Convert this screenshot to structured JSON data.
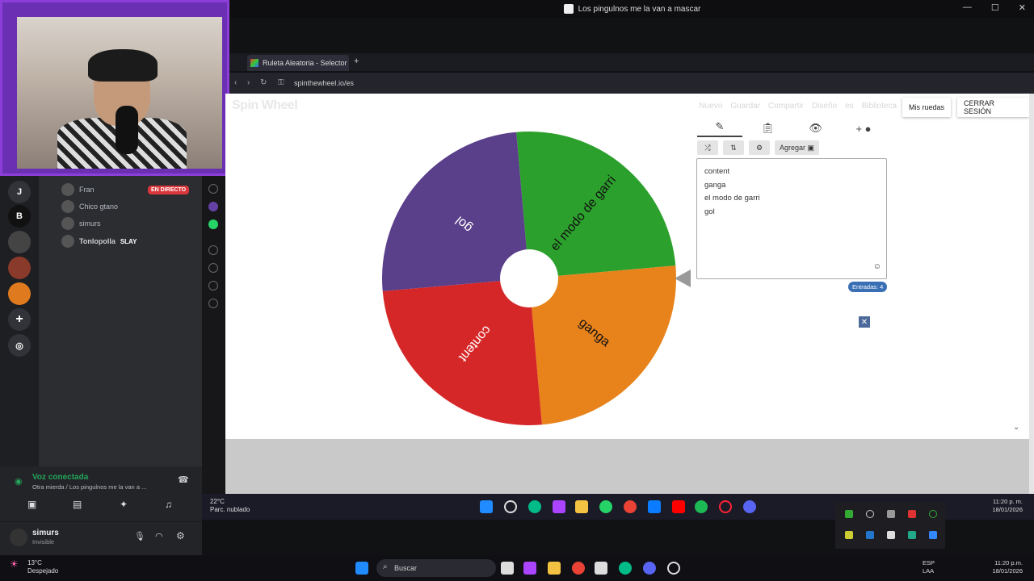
{
  "stream_window": {
    "title": "Los pingulnos me la van a mascar"
  },
  "browser": {
    "tab_title": "Ruleta Aleatoria - Selector",
    "url": "spinthewheel.io/es"
  },
  "site": {
    "logo": "Spin Wheel",
    "nav": [
      "Nuevo",
      "Guardar",
      "Compartir",
      "Diseño",
      "es",
      "Biblioteca"
    ],
    "my_wheels": "Mis ruedas",
    "logout": "CERRAR SESIÓN",
    "add_image": "Agregar",
    "entries_text": [
      "content",
      "ganga",
      "el modo de garri",
      "gol"
    ],
    "entries_count": "Entradas: 4"
  },
  "wheel": {
    "segments": [
      {
        "label": "el modo de garri",
        "color": "#2ca02c"
      },
      {
        "label": "ganga",
        "color": "#e8831c"
      },
      {
        "label": "content",
        "color": "#d62728"
      },
      {
        "label": "gol",
        "color": "#5a3f8a"
      }
    ]
  },
  "discord": {
    "servers": [
      "J",
      "B"
    ],
    "voice_users": [
      {
        "name": "Fran",
        "live": "EN DIRECTO"
      },
      {
        "name": "Chico gtano"
      },
      {
        "name": "simurs"
      },
      {
        "name": "Tonlopolla",
        "tag": "SLAY"
      }
    ],
    "voice_status": "Voz conectada",
    "voice_channel": "Otra mierda / Los pingulnos me la van a ...",
    "user_name": "simurs",
    "user_status": "Invisible"
  },
  "stream_taskbar": {
    "temp": "22°C",
    "weather": "Parc. nublado",
    "time": "11:20 p. m.",
    "date": "18/01/2026"
  },
  "taskbar": {
    "temp": "13°C",
    "weather": "Despejado",
    "search": "Buscar",
    "lang1": "ESP",
    "lang2": "LAA",
    "time": "11:20 p.m.",
    "date": "18/01/2026"
  }
}
